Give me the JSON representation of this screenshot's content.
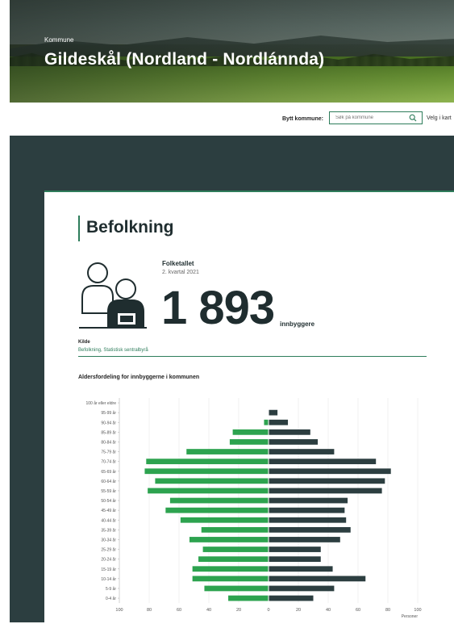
{
  "header": {
    "label": "Kommune",
    "title": "Gildeskål (Nordland - Nordlánnda)"
  },
  "controls": {
    "bytt_label": "Bytt kommune:",
    "search_placeholder": "Søk på kommune",
    "velg_link": "Velg i kart"
  },
  "section": {
    "title": "Befolkning",
    "folketallet_label": "Folketallet",
    "period": "2. kvartal 2021",
    "population": "1 893",
    "unit": "innbyggere",
    "kilde_label": "Kilde",
    "kilde_link": "Befolkning, Statistisk sentralbyrå"
  },
  "colors": {
    "accent": "#2e7d5b",
    "dark_bg": "#2c3e40",
    "bar_green": "#2da34f",
    "bar_dark": "#2c3e40"
  },
  "chart_data": {
    "type": "bar",
    "title": "Aldersfordeling for innbyggerne i kommunen",
    "xlabel": "Personer",
    "orientation": "horizontal",
    "categories": [
      "100 år eller eldre",
      "95-99 år",
      "90-94 år",
      "85-89 år",
      "80-84 år",
      "75-79 år",
      "70-74 år",
      "65-69 år",
      "60-64 år",
      "55-59 år",
      "50-54 år",
      "45-49 år",
      "40-44 år",
      "35-39 år",
      "30-34 år",
      "25-29 år",
      "20-24 år",
      "15-19 år",
      "10-14 år",
      "5-9 år",
      "0-4 år"
    ],
    "series": [
      {
        "values": [
          0,
          0,
          3,
          24,
          26,
          55,
          82,
          83,
          76,
          81,
          66,
          69,
          59,
          45,
          53,
          44,
          47,
          51,
          51,
          43,
          27
        ]
      },
      {
        "values": [
          0,
          6,
          13,
          28,
          33,
          44,
          72,
          82,
          78,
          76,
          53,
          51,
          52,
          55,
          48,
          35,
          35,
          43,
          65,
          44,
          30
        ]
      }
    ],
    "xlim": [
      -100,
      100
    ],
    "xticks": [
      "100",
      "80",
      "60",
      "40",
      "20",
      "0",
      "20",
      "40",
      "60",
      "80",
      "100"
    ],
    "grid": true
  }
}
